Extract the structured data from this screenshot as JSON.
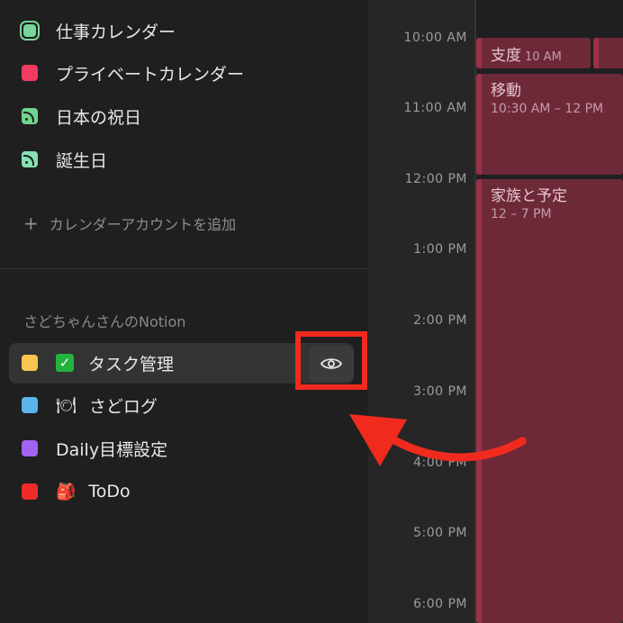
{
  "calendars": [
    {
      "label": "仕事カレンダー",
      "color": "#79d59c",
      "icon": "ring-square-icon"
    },
    {
      "label": "プライベートカレンダー",
      "color": "#f23a62",
      "icon": "square-icon"
    },
    {
      "label": "日本の祝日",
      "color": "#72d48f",
      "icon": "rss-feed-icon"
    },
    {
      "label": "誕生日",
      "color": "#86e0b4",
      "icon": "rss-feed-icon"
    }
  ],
  "add_account": {
    "plus": "+",
    "label": "カレンダーアカウントを追加"
  },
  "notion_section": {
    "header": "さどちゃんさんのNotion"
  },
  "notion_items": [
    {
      "label": "タスク管理",
      "color": "#f8c64e",
      "emoji": "✓"
    },
    {
      "label": "さどログ",
      "color": "#5db3ec",
      "emoji": "🍽"
    },
    {
      "label": "Daily目標設定",
      "color": "#a362f2",
      "emoji": ""
    },
    {
      "label": "ToDo",
      "color": "#ef2b2b",
      "emoji": "🎒"
    }
  ],
  "time_labels": [
    "10:00 AM",
    "11:00 AM",
    "12:00 PM",
    "1:00 PM",
    "2:00 PM",
    "3:00 PM",
    "4:00 PM",
    "5:00 PM",
    "6:00 PM"
  ],
  "events": [
    {
      "title": "支度",
      "time": "10 AM"
    },
    {
      "title": "移動",
      "time": "10:30 AM – 12 PM"
    },
    {
      "title": "家族と予定",
      "time": "12 – 7 PM"
    }
  ]
}
